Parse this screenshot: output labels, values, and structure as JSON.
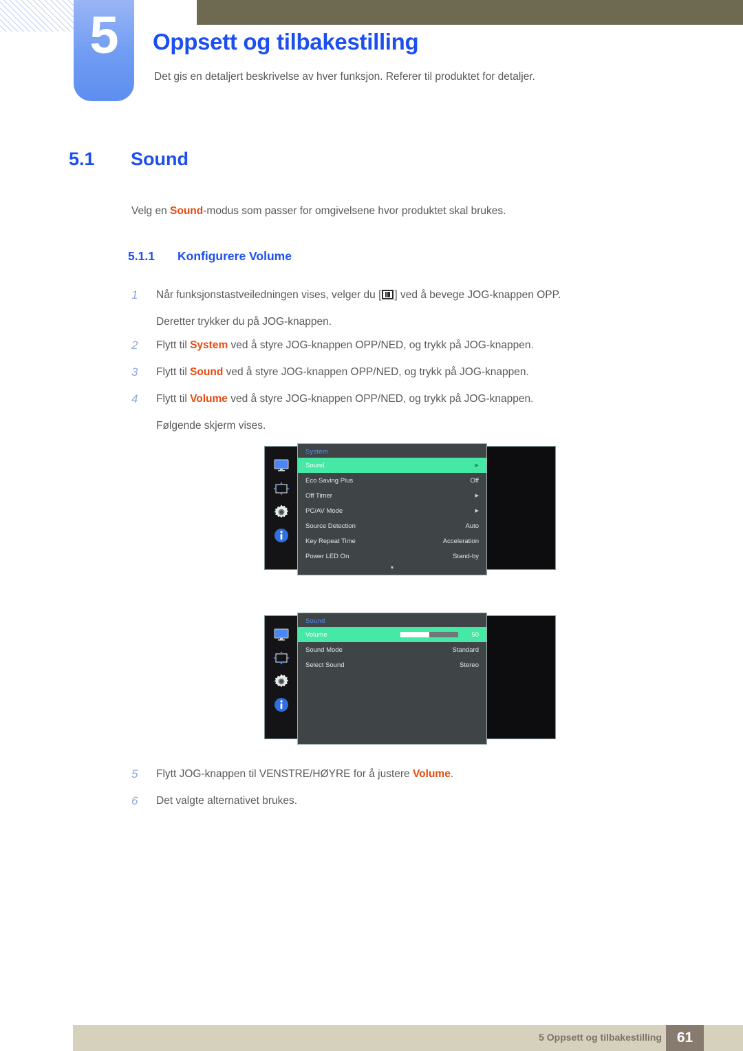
{
  "header": {
    "chapter_number": "5",
    "chapter_title": "Oppsett og tilbakestilling",
    "chapter_subtitle": "Det gis en detaljert beskrivelse av hver funksjon. Referer til produktet for detaljer."
  },
  "section": {
    "number": "5.1",
    "title": "Sound",
    "intro_prefix": "Velg en ",
    "intro_highlight": "Sound",
    "intro_suffix": "-modus som passer for omgivelsene hvor produktet skal brukes."
  },
  "subsection": {
    "number": "5.1.1",
    "title": "Konfigurere Volume"
  },
  "steps_top": [
    {
      "num": "1",
      "pre": "Når funksjonstastveiledningen vises, velger du [",
      "icon": "menu-grid-icon",
      "post": "] ved å bevege JOG-knappen OPP.",
      "continuation": "Deretter trykker du på JOG-knappen."
    },
    {
      "num": "2",
      "pre": "Flytt til ",
      "highlight": "System",
      "post": " ved å styre JOG-knappen OPP/NED, og trykk på JOG-knappen."
    },
    {
      "num": "3",
      "pre": "Flytt til ",
      "highlight": "Sound",
      "post": " ved å styre JOG-knappen OPP/NED, og trykk på JOG-knappen."
    },
    {
      "num": "4",
      "pre": "Flytt til ",
      "highlight": "Volume",
      "post": " ved å styre JOG-knappen OPP/NED, og trykk på JOG-knappen.",
      "continuation": "Følgende skjerm vises."
    }
  ],
  "steps_bottom": [
    {
      "num": "5",
      "pre": "Flytt JOG-knappen til VENSTRE/HØYRE for å justere ",
      "highlight": "Volume",
      "post": "."
    },
    {
      "num": "6",
      "pre": "Det valgte alternativet brukes."
    }
  ],
  "osd_system": {
    "title": "System",
    "rail_icons": [
      "monitor-icon",
      "move-arrows-icon",
      "gear-icon",
      "info-icon"
    ],
    "rows": [
      {
        "label": "Sound",
        "value": "",
        "arrow": "▶",
        "selected": true
      },
      {
        "label": "Eco Saving Plus",
        "value": "Off",
        "arrow": "",
        "selected": false
      },
      {
        "label": "Off Timer",
        "value": "",
        "arrow": "▶",
        "selected": false
      },
      {
        "label": "PC/AV Mode",
        "value": "",
        "arrow": "▶",
        "selected": false
      },
      {
        "label": "Source Detection",
        "value": "Auto",
        "arrow": "",
        "selected": false
      },
      {
        "label": "Key Repeat Time",
        "value": "Acceleration",
        "arrow": "",
        "selected": false
      },
      {
        "label": "Power LED On",
        "value": "Stand-by",
        "arrow": "",
        "selected": false
      }
    ],
    "more_indicator": "▼"
  },
  "osd_sound": {
    "title": "Sound",
    "rail_icons": [
      "monitor-icon",
      "move-arrows-icon",
      "gear-icon",
      "info-icon"
    ],
    "rows": [
      {
        "label": "Volume",
        "value": "50",
        "slider": 50,
        "selected": true
      },
      {
        "label": "Sound Mode",
        "value": "Standard",
        "selected": false
      },
      {
        "label": "Select Sound",
        "value": "Stereo",
        "selected": false
      }
    ]
  },
  "footer": {
    "text": "5 Oppsett og tilbakestilling",
    "page": "61"
  },
  "colors": {
    "heading_blue": "#1c4ef0",
    "highlight_orange": "#e8490f",
    "osd_select_green": "#46e8a6",
    "footer_beige": "#d6d1bd",
    "footer_page_brown": "#877a6e",
    "olive_bar": "#6e6a51"
  }
}
